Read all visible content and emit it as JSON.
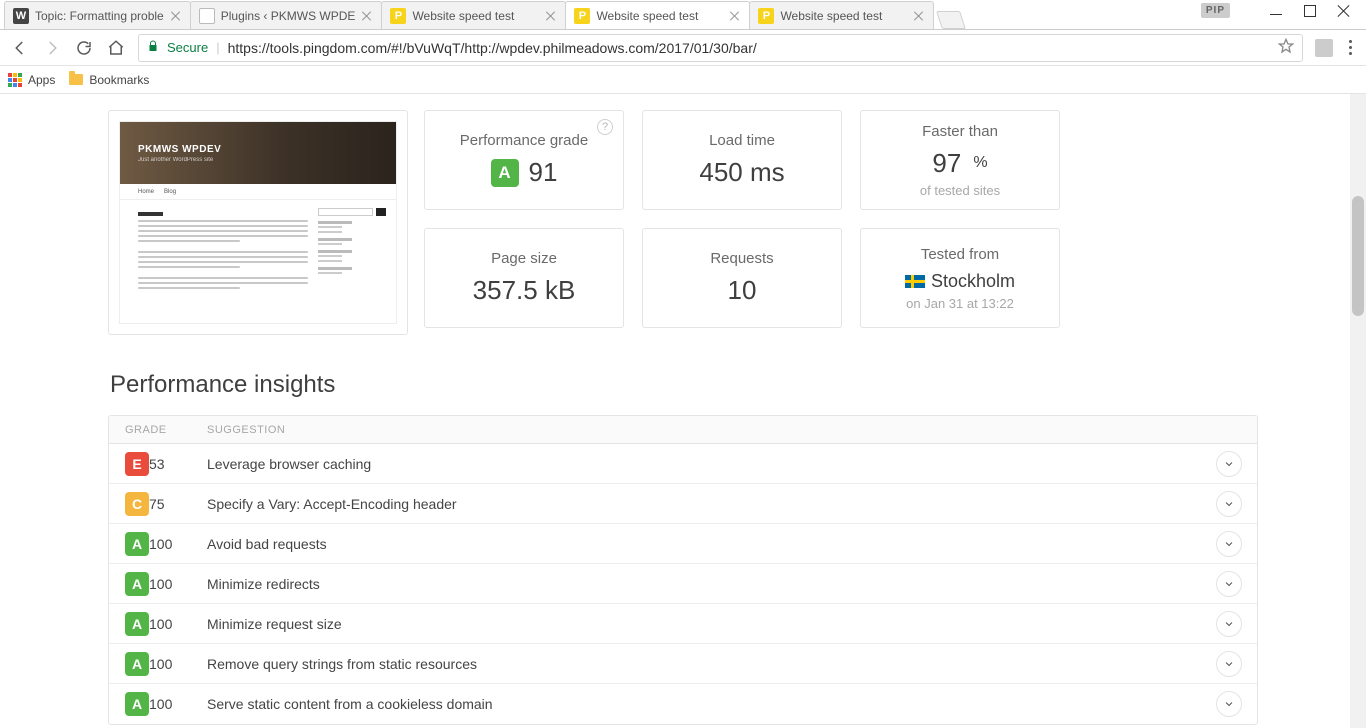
{
  "os_controls": {
    "pip": "PIP"
  },
  "tabs": [
    {
      "title": "Topic: Formatting proble",
      "fav": "W",
      "favcls": "fav-w",
      "active": false
    },
    {
      "title": "Plugins ‹ PKMWS WPDE",
      "fav": "",
      "favcls": "fav-doc",
      "active": false
    },
    {
      "title": "Website speed test",
      "fav": "P",
      "favcls": "fav-p",
      "active": false
    },
    {
      "title": "Website speed test",
      "fav": "P",
      "favcls": "fav-p",
      "active": true
    },
    {
      "title": "Website speed test",
      "fav": "P",
      "favcls": "fav-p",
      "active": false
    }
  ],
  "toolbar": {
    "secure_label": "Secure",
    "url": "https://tools.pingdom.com/#!/bVuWqT/http://wpdev.philmeadows.com/2017/01/30/bar/"
  },
  "bookmarks": {
    "apps": "Apps",
    "folder1": "Bookmarks"
  },
  "thumbnail": {
    "site_title": "PKMWS WPDEV",
    "site_sub": "Just another WordPress site",
    "nav1": "Home",
    "nav2": "Blog"
  },
  "summary": {
    "perf_label": "Performance grade",
    "perf_grade": "A",
    "perf_score": "91",
    "load_label": "Load time",
    "load_value": "450 ms",
    "faster_label": "Faster than",
    "faster_value": "97",
    "faster_unit": "%",
    "faster_sub": "of tested sites",
    "size_label": "Page size",
    "size_value": "357.5 kB",
    "req_label": "Requests",
    "req_value": "10",
    "tested_label": "Tested from",
    "tested_loc": "Stockholm",
    "tested_time": "on Jan 31 at 13:22"
  },
  "insights": {
    "heading": "Performance insights",
    "head_grade": "GRADE",
    "head_sugg": "SUGGESTION",
    "rows": [
      {
        "grade": "E",
        "score": "53",
        "sugg": "Leverage browser caching"
      },
      {
        "grade": "C",
        "score": "75",
        "sugg": "Specify a Vary: Accept-Encoding header"
      },
      {
        "grade": "A",
        "score": "100",
        "sugg": "Avoid bad requests"
      },
      {
        "grade": "A",
        "score": "100",
        "sugg": "Minimize redirects"
      },
      {
        "grade": "A",
        "score": "100",
        "sugg": "Minimize request size"
      },
      {
        "grade": "A",
        "score": "100",
        "sugg": "Remove query strings from static resources"
      },
      {
        "grade": "A",
        "score": "100",
        "sugg": "Serve static content from a cookieless domain"
      }
    ]
  }
}
